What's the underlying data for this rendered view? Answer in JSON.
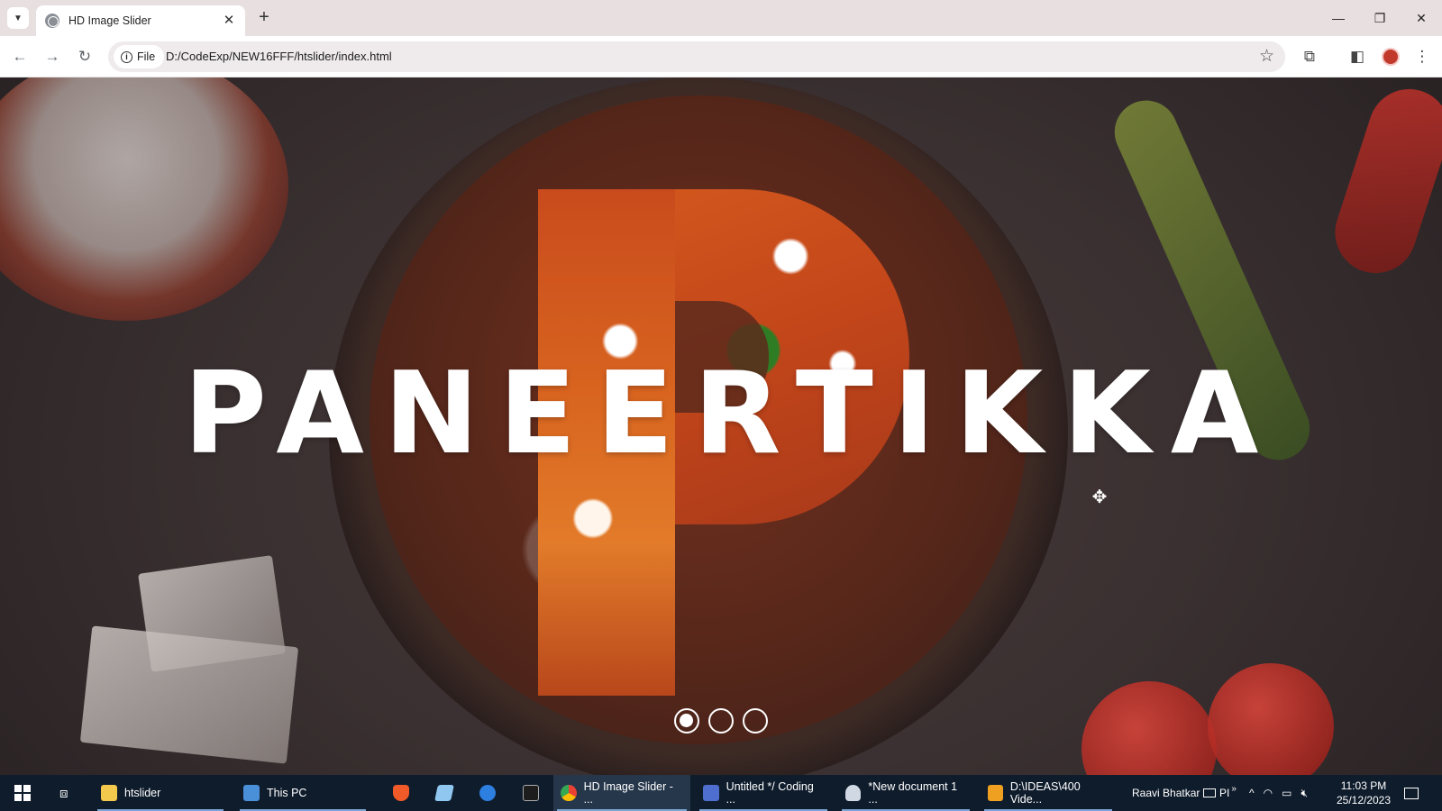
{
  "browser": {
    "tab_title": "HD Image Slider",
    "tab_close": "✕",
    "new_tab": "+",
    "security_chip": "File",
    "url": "D:/CodeExp/NEW16FFF/htslider/index.html",
    "window_controls": {
      "minimize": "—",
      "restore": "❐",
      "close": "✕"
    }
  },
  "slider": {
    "title": "PANEERTIKKA",
    "dots": [
      {
        "active": true
      },
      {
        "active": false
      },
      {
        "active": false
      }
    ]
  },
  "taskbar": {
    "items": [
      {
        "label": "htslider",
        "color": "#f2c94c"
      },
      {
        "label": "This PC",
        "color": "#4a90d9"
      },
      {
        "label": "HD Image Slider - ...",
        "color": "#e94235"
      },
      {
        "label": "Untitled */ Coding ...",
        "color": "#4f6fd0"
      },
      {
        "label": "*New document 1 ...",
        "color": "#cfd8e3"
      },
      {
        "label": "D:\\IDEAS\\400 Vide...",
        "color": "#f0a020"
      }
    ],
    "user": "Raavi Bhatkar",
    "tray_text": "PI",
    "time": "11:03 PM",
    "date": "25/12/2023"
  }
}
